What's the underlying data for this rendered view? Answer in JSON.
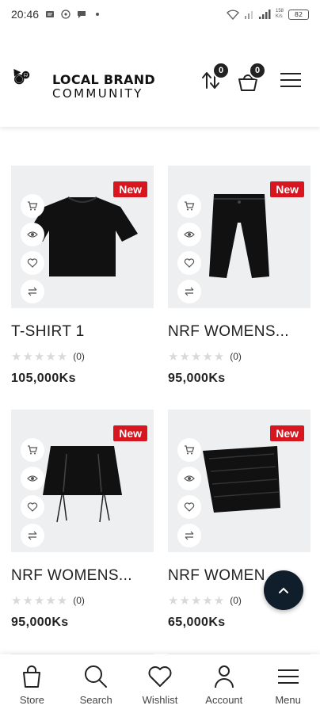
{
  "status_bar": {
    "time": "20:46",
    "battery": "82",
    "speed_top": "158",
    "speed_bottom": "K/s"
  },
  "header": {
    "brand_line1": "LOCAL BRAND",
    "brand_line2": "COMMUNITY",
    "compare_count": "0",
    "cart_count": "0"
  },
  "products": [
    {
      "badge": "New",
      "title": "T-SHIRT 1",
      "rating_count": "(0)",
      "price": "105,000Ks",
      "rating": 0
    },
    {
      "badge": "New",
      "title": "NRF WOMENS...",
      "rating_count": "(0)",
      "price": "95,000Ks",
      "rating": 0
    },
    {
      "badge": "New",
      "title": "NRF WOMENS...",
      "rating_count": "(0)",
      "price": "95,000Ks",
      "rating": 0
    },
    {
      "badge": "New",
      "title": "NRF WOMEN",
      "rating_count": "(0)",
      "price": "65,000Ks",
      "rating": 0
    }
  ],
  "bottom_nav": {
    "store": "Store",
    "search": "Search",
    "wishlist": "Wishlist",
    "account": "Account",
    "menu": "Menu"
  },
  "colors": {
    "badge_red": "#d7161f",
    "to_top_bg": "#101d2b",
    "image_bg": "#eeeff1"
  }
}
